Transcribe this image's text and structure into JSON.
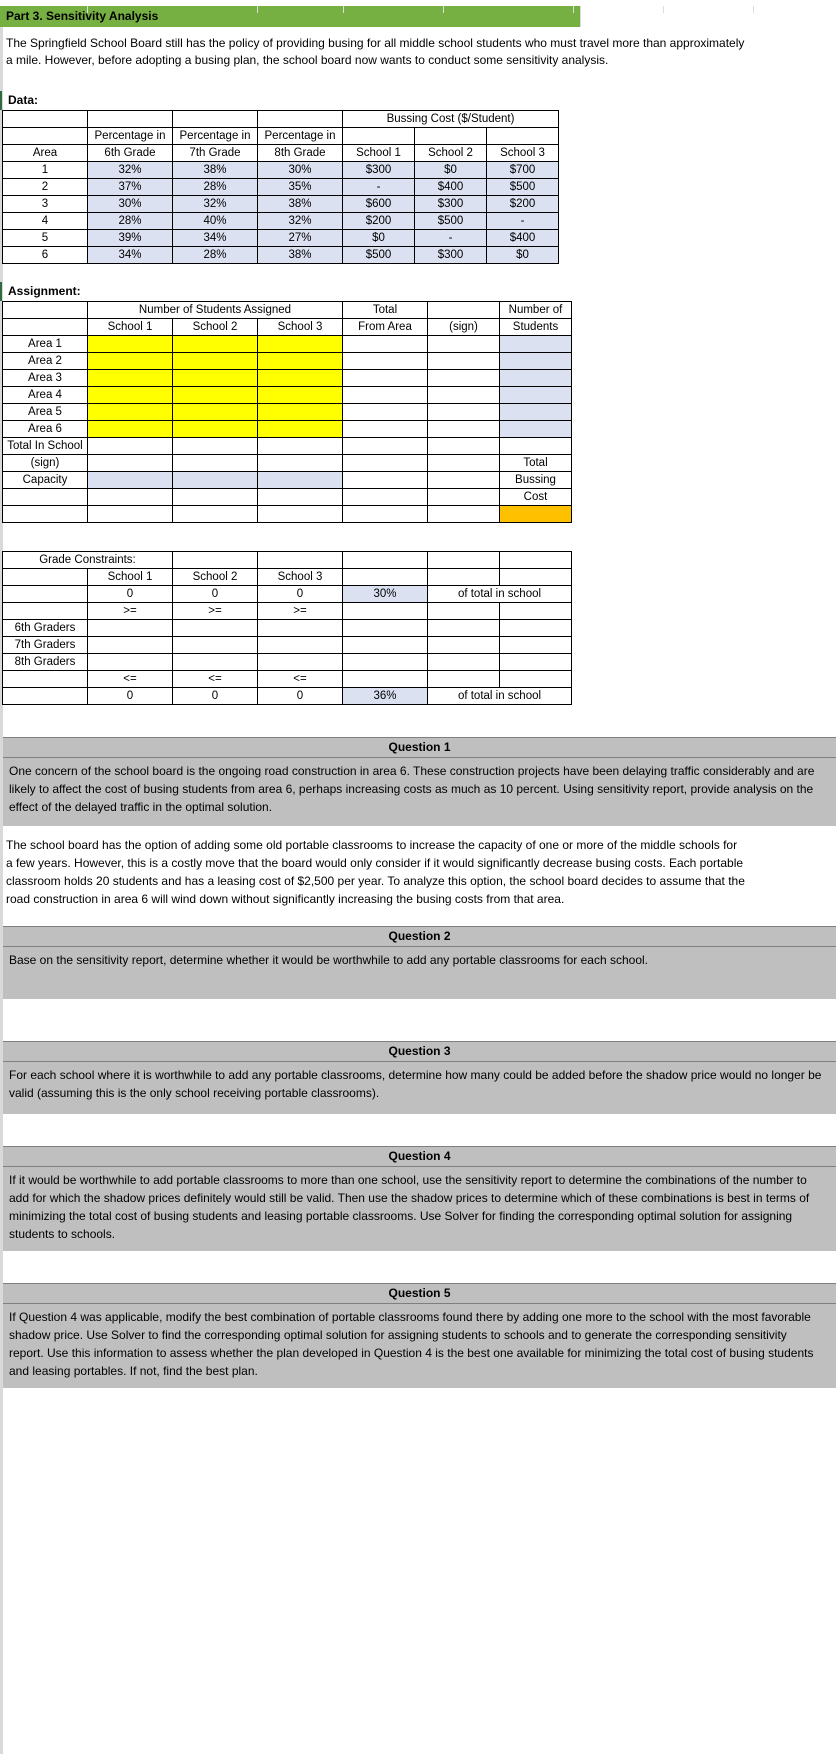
{
  "banner": {
    "title": "Part 3. Sensitivity Analysis"
  },
  "intro": {
    "paragraph": "The Springfield School Board still has the policy of providing busing for all middle school students who must travel more than approximately a mile.  However, before adopting a busing plan, the school board now wants to conduct some sensitivity analysis."
  },
  "data_section": {
    "heading": "Data:",
    "group_header": "Bussing Cost ($/Student)",
    "headers": {
      "area": "Area",
      "pct6_line1": "Percentage in",
      "pct6_line2": "6th Grade",
      "pct7_line1": "Percentage in",
      "pct7_line2": "7th Grade",
      "pct8_line1": "Percentage in",
      "pct8_line2": "8th Grade",
      "school1": "School 1",
      "school2": "School 2",
      "school3": "School 3"
    },
    "rows": [
      {
        "area": "1",
        "pct6": "32%",
        "pct7": "38%",
        "pct8": "30%",
        "s1": "$300",
        "s2": "$0",
        "s3": "$700"
      },
      {
        "area": "2",
        "pct6": "37%",
        "pct7": "28%",
        "pct8": "35%",
        "s1": "-",
        "s2": "$400",
        "s3": "$500"
      },
      {
        "area": "3",
        "pct6": "30%",
        "pct7": "32%",
        "pct8": "38%",
        "s1": "$600",
        "s2": "$300",
        "s3": "$200"
      },
      {
        "area": "4",
        "pct6": "28%",
        "pct7": "40%",
        "pct8": "32%",
        "s1": "$200",
        "s2": "$500",
        "s3": "-"
      },
      {
        "area": "5",
        "pct6": "39%",
        "pct7": "34%",
        "pct8": "27%",
        "s1": "$0",
        "s2": "-",
        "s3": "$400"
      },
      {
        "area": "6",
        "pct6": "34%",
        "pct7": "28%",
        "pct8": "38%",
        "s1": "$500",
        "s2": "$300",
        "s3": "$0"
      }
    ]
  },
  "assignment_section": {
    "heading": "Assignment:",
    "group_header": "Number of Students Assigned",
    "headers": {
      "total_line1": "Total",
      "total_line2": "From Area",
      "sign_line1": "",
      "sign_line2": "(sign)",
      "num_line1": "Number of",
      "num_line2": "Students",
      "school1": "School 1",
      "school2": "School 2",
      "school3": "School 3"
    },
    "area_rows": [
      {
        "label": "Area 1"
      },
      {
        "label": "Area 2"
      },
      {
        "label": "Area 3"
      },
      {
        "label": "Area 4"
      },
      {
        "label": "Area 5"
      },
      {
        "label": "Area 6"
      }
    ],
    "total_in_school_label": "Total In School",
    "sign_label": "(sign)",
    "capacity_label": "Capacity",
    "total_label": "Total",
    "bussing_label": "Bussing",
    "cost_label": "Cost"
  },
  "grade_section": {
    "heading": "Grade Constraints:",
    "headers": {
      "school1": "School 1",
      "school2": "School 2",
      "school3": "School 3"
    },
    "min_values": {
      "s1": "0",
      "s2": "0",
      "s3": "0"
    },
    "min_pct": "30%",
    "min_note": "of total in school",
    "min_sign": ">=",
    "grade_rows": [
      {
        "label": "6th Graders"
      },
      {
        "label": "7th Graders"
      },
      {
        "label": "8th Graders"
      }
    ],
    "max_sign": "<=",
    "max_values": {
      "s1": "0",
      "s2": "0",
      "s3": "0"
    },
    "max_pct": "36%",
    "max_note": "of total in school"
  },
  "questions": [
    {
      "title": "Question 1",
      "body": "One concern of the school board is the ongoing road construction in area 6. These construction projects have been delaying traffic considerably and are likely to affect the cost of busing students from area 6, perhaps increasing costs as much as 10 percent. Using sensitivity report, provide analysis on the effect of the delayed traffic in the optimal solution."
    },
    {
      "title": "Question 2",
      "body": "Base on the sensitivity report, determine whether it would be worthwhile to add any portable classrooms for each school."
    },
    {
      "title": "Question 3",
      "body": "For each school where it is worthwhile to add any portable classrooms,  determine how many could be added before the shadow price would no longer be valid (assuming this is the only school receiving portable classrooms)."
    },
    {
      "title": "Question 4",
      "body": "If it would be worthwhile to add portable classrooms to more than one school, use the sensitivity report to determine the combinations of the number to add for which the shadow prices definitely would still be valid. Then use the shadow prices to determine which of these combinations is best in terms of minimizing the total cost of busing students and leasing portable classrooms. Use Solver for finding the corresponding optimal solution for assigning students to schools."
    },
    {
      "title": "Question 5",
      "body": "If Question 4 was applicable, modify the best combination of portable classrooms found there by adding one more to the school with the most favorable shadow price. Use Solver to find the corresponding optimal solution for assigning students to schools and to generate the corresponding sensitivity report. Use this information to assess whether the plan developed in Question 4 is the best one available for minimizing the total cost of busing students and leasing portables. If not, find the best plan."
    }
  ],
  "mid_paragraph": "The school board has the option of adding some old portable classrooms to increase the capacity of one or more of the middle schools for a few years. However, this is a costly move that the board would only consider if it would significantly decrease busing costs. Each portable classroom holds 20 students and has a leasing cost of $2,500 per year. To analyze this option, the school board decides to assume that the road construction in area 6 will wind down without significantly increasing the busing costs from that area.",
  "colors": {
    "banner_green": "#76b043",
    "input_blue": "#dce1f2",
    "changing_yellow": "#ffff00",
    "objective_orange": "#ffc000",
    "question_grey": "#bfbfbf",
    "dashed_green": "#2e7d4f"
  }
}
